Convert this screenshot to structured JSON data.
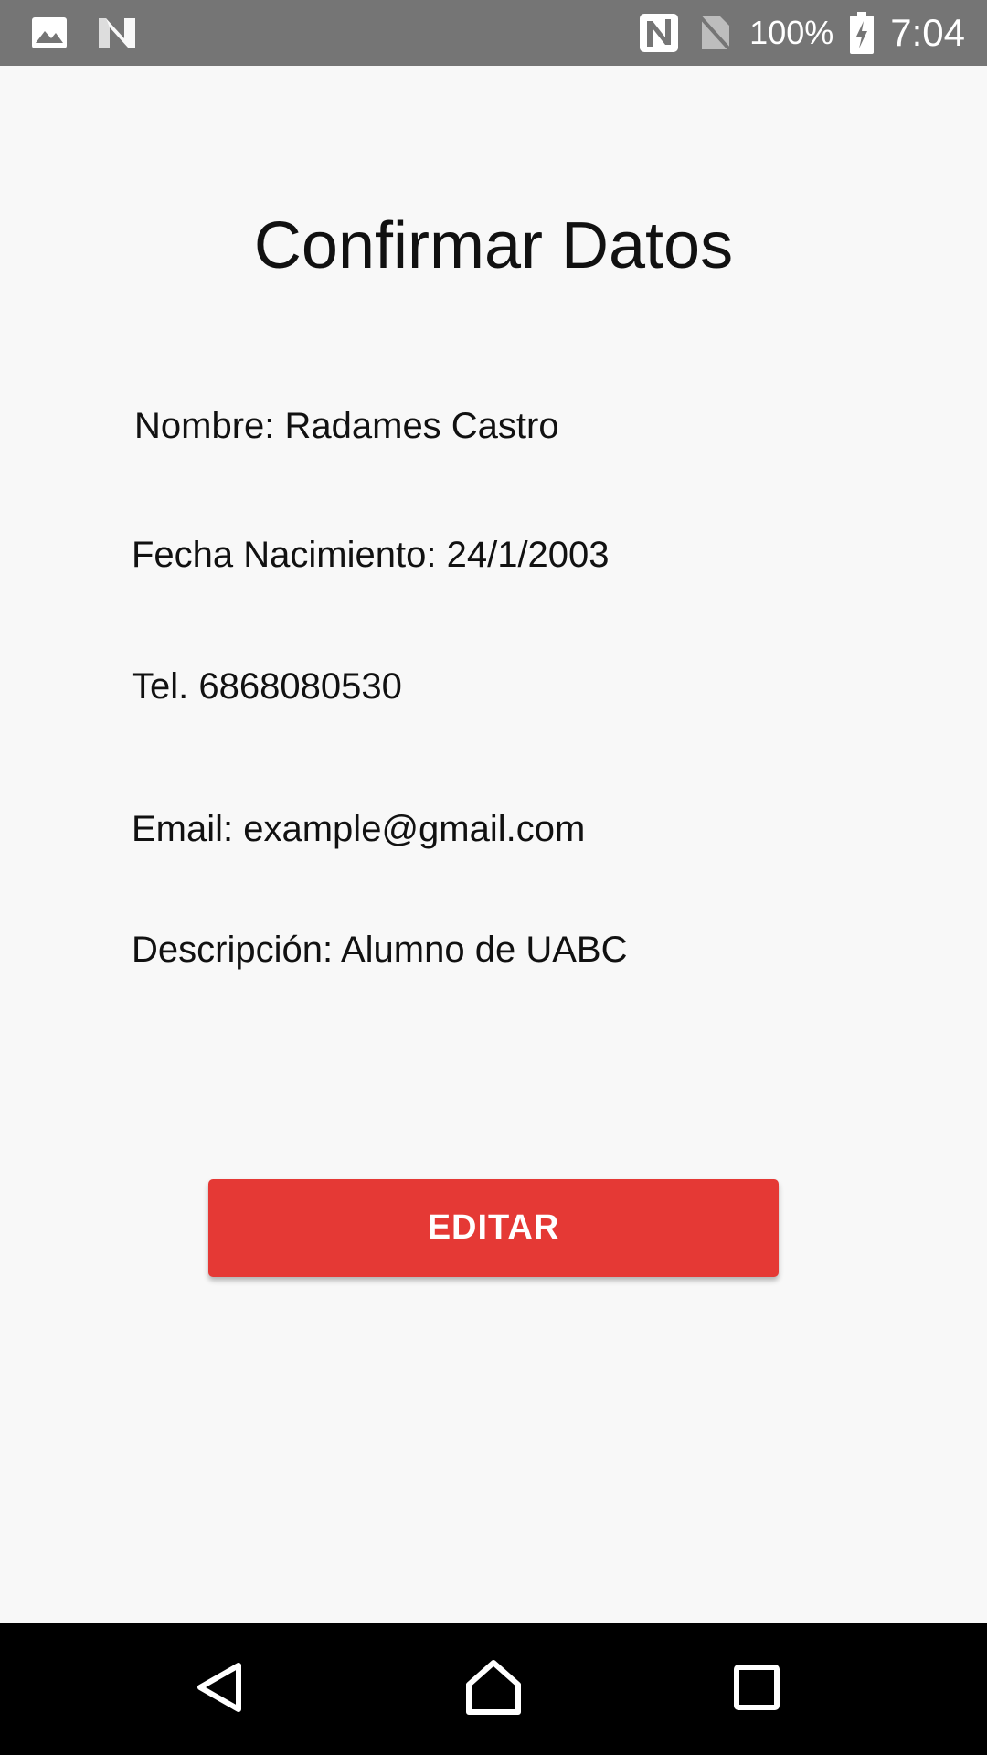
{
  "status_bar": {
    "left_icons": [
      "image-icon",
      "n-notification-icon"
    ],
    "right_icons": [
      "nfc-icon",
      "no-sim-icon",
      "battery-charging-icon"
    ],
    "battery_percent": "100%",
    "time": "7:04"
  },
  "screen": {
    "title": "Confirmar Datos",
    "fields": {
      "nombre": "Nombre: Radames Castro",
      "fecha_nacimiento": "Fecha Nacimiento: 24/1/2003",
      "telefono": "Tel. 6868080530",
      "email": "Email: example@gmail.com",
      "descripcion": "Descripción: Alumno de UABC"
    },
    "edit_button_label": "EDITAR"
  },
  "nav_bar": {
    "buttons": [
      "back-icon",
      "home-icon",
      "recents-icon"
    ]
  },
  "colors": {
    "status_bar": "#757575",
    "background": "#f8f8f8",
    "accent_button": "#e53935",
    "nav_bar": "#000000"
  }
}
